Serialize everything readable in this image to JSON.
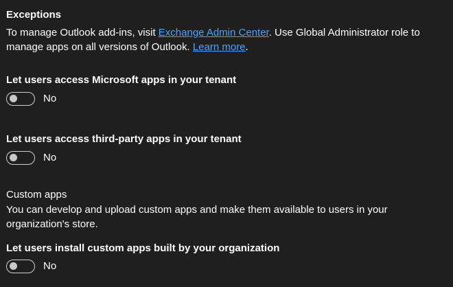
{
  "exceptions": {
    "title": "Exceptions",
    "text_1": "To manage Outlook add-ins, visit ",
    "link_admin": "Exchange Admin Center",
    "text_2": ". Use Global Administrator role to manage apps on all versions of Outlook. ",
    "link_learn": "Learn more",
    "text_3": "."
  },
  "settings": [
    {
      "label": "Let users access Microsoft apps in your tenant",
      "state": "No",
      "enabled": false
    },
    {
      "label": "Let users access third-party apps in your tenant",
      "state": "No",
      "enabled": false
    }
  ],
  "custom_apps": {
    "title": "Custom apps",
    "description": "You can develop and upload custom apps and make them available to users in your organization's store.",
    "setting": {
      "label": "Let users install custom apps built by your organization",
      "state": "No",
      "enabled": false
    }
  },
  "colors": {
    "background": "#1f1f1f",
    "text": "#ffffff",
    "link": "#4aa3ff",
    "toggle_off_border": "#d0d0d0"
  }
}
